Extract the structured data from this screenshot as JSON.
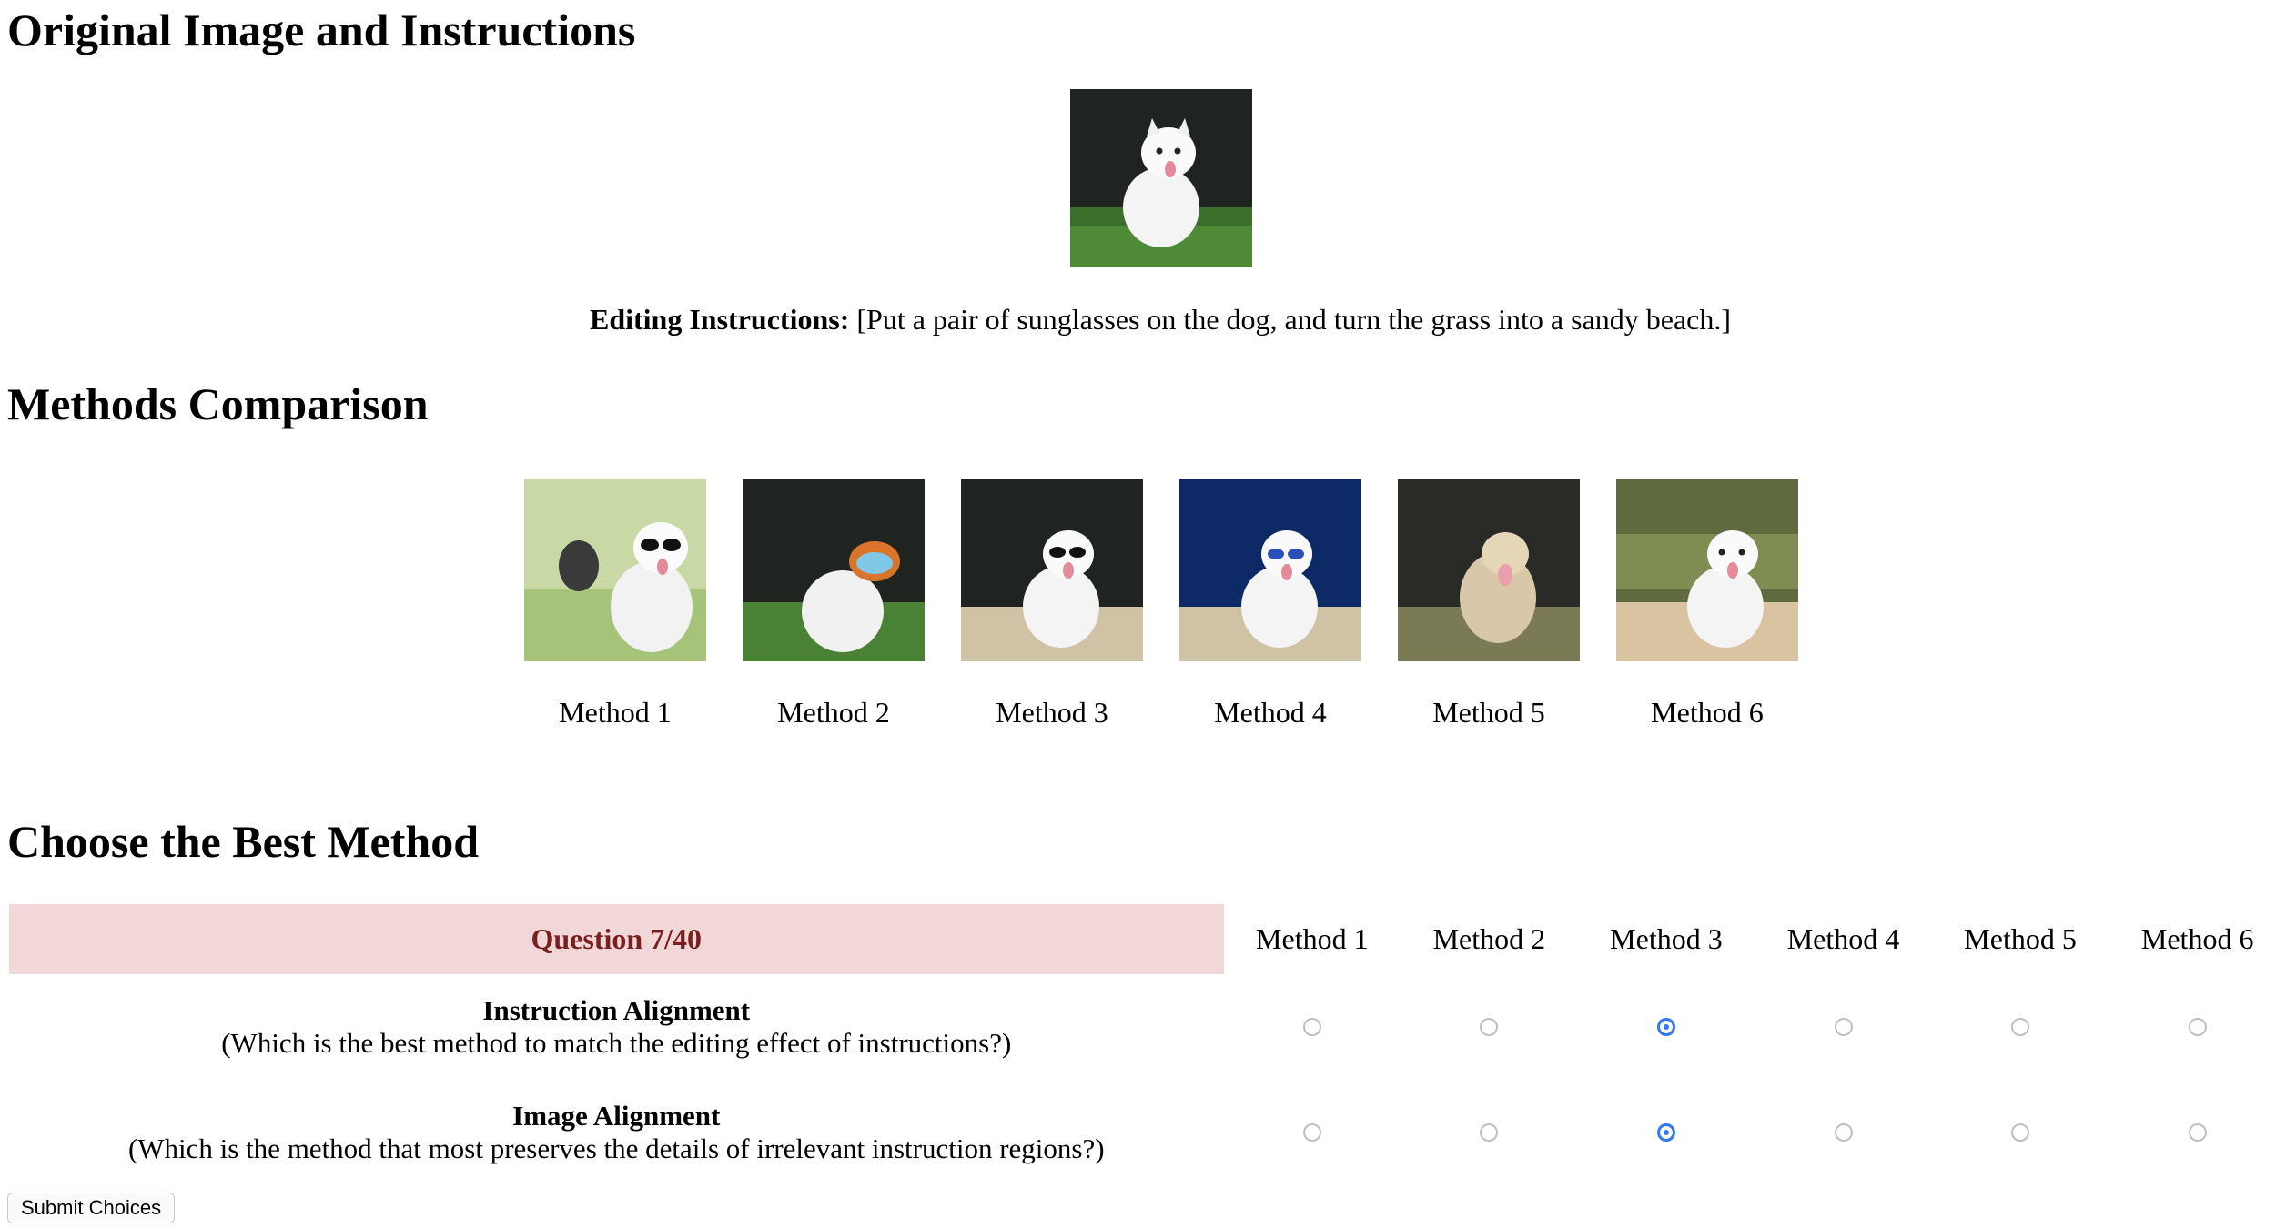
{
  "headings": {
    "original": "Original Image and Instructions",
    "methods": "Methods Comparison",
    "choose": "Choose the Best Method"
  },
  "instructions": {
    "label": "Editing Instructions:",
    "text": "[Put a pair of sunglasses on the dog, and turn the grass into a sandy beach.]"
  },
  "methods": [
    {
      "label": "Method 1"
    },
    {
      "label": "Method 2"
    },
    {
      "label": "Method 3"
    },
    {
      "label": "Method 4"
    },
    {
      "label": "Method 5"
    },
    {
      "label": "Method 6"
    }
  ],
  "question": {
    "header": "Question 7/40",
    "columns": [
      "Method 1",
      "Method 2",
      "Method 3",
      "Method 4",
      "Method 5",
      "Method 6"
    ],
    "rows": [
      {
        "title": "Instruction Alignment",
        "subtitle": "(Which is the best method to match the editing effect of instructions?)",
        "selected": 2
      },
      {
        "title": "Image Alignment",
        "subtitle": "(Which is the method that most preserves the details of irrelevant instruction regions?)",
        "selected": 2
      }
    ]
  },
  "submit_label": "Submit Choices",
  "colors": {
    "question_bg": "#f2d7d9",
    "question_text": "#7a1f1f",
    "radio_accent": "#3478f6"
  }
}
